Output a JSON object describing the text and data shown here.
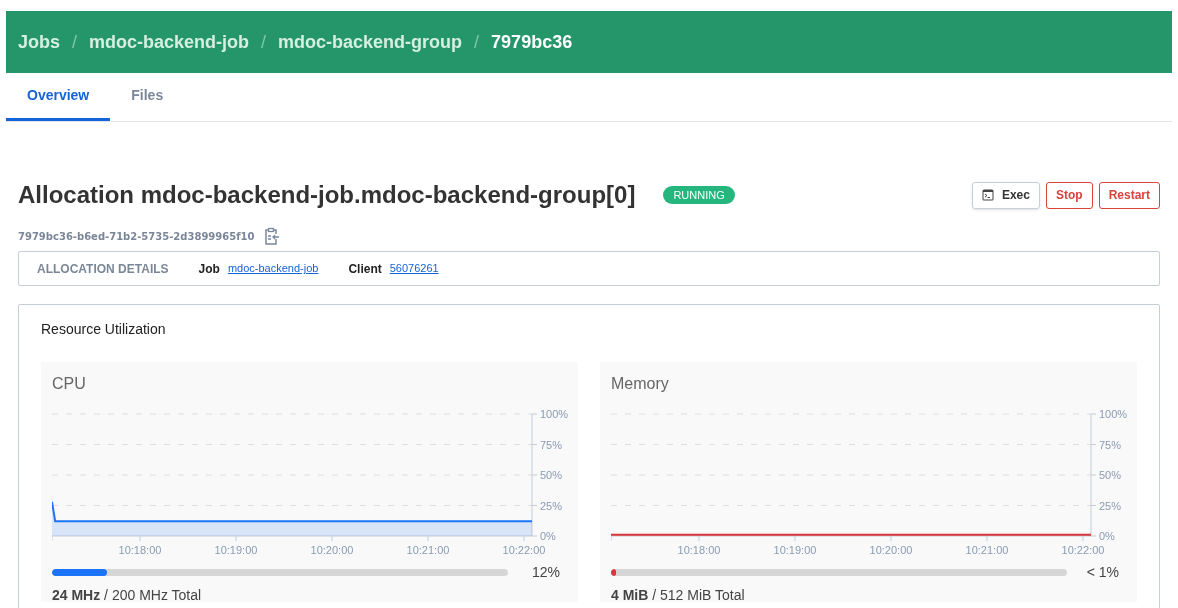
{
  "breadcrumbs": [
    "Jobs",
    "mdoc-backend-job",
    "mdoc-backend-group",
    "7979bc36"
  ],
  "breadcrumb_separator": "/",
  "tabs": [
    {
      "label": "Overview",
      "selected": true
    },
    {
      "label": "Files",
      "selected": false
    }
  ],
  "title": "Allocation mdoc-backend-job.mdoc-backend-group[0]",
  "status": "RUNNING",
  "actions": [
    {
      "label": "Exec",
      "kind": "exec"
    },
    {
      "label": "Stop",
      "kind": "danger"
    },
    {
      "label": "Restart",
      "kind": "danger"
    }
  ],
  "allocation_id": "7979bc36-b6ed-71b2-5735-2d3899965f10",
  "details": {
    "heading": "ALLOCATION DETAILS",
    "fields": [
      {
        "label": "Job",
        "value": "mdoc-backend-job"
      },
      {
        "label": "Client",
        "value": "56076261"
      }
    ]
  },
  "resource_utilization": {
    "title": "Resource Utilization",
    "panels": [
      {
        "title": "CPU",
        "level": 0.12,
        "reading": "12%",
        "summary": "**24 MHz** / 200 MHz Total",
        "chart_data": {
          "type": "area",
          "grid": true,
          "x": [
            37025,
            37027,
            37325
          ],
          "series": [
            {
              "color": "#1a73f8",
              "values": [
                28,
                12,
                12
              ]
            }
          ],
          "xlim": [
            37025,
            37325
          ],
          "ylim": [
            0,
            100
          ],
          "xticks": [
            {
              "value": 37080,
              "label": "10:18:00"
            },
            {
              "value": 37140,
              "label": "10:19:00"
            },
            {
              "value": 37200,
              "label": "10:20:00"
            },
            {
              "value": 37260,
              "label": "10:21:00"
            },
            {
              "value": 37320,
              "label": "10:22:00"
            }
          ],
          "yticks": [
            {
              "value": 0,
              "label": "0%"
            },
            {
              "value": 25,
              "label": "25%"
            },
            {
              "value": 50,
              "label": "50%"
            },
            {
              "value": 75,
              "label": "75%"
            },
            {
              "value": 100,
              "label": "100%"
            }
          ]
        }
      },
      {
        "title": "Memory",
        "level": 0.008,
        "reading": "< 1%",
        "summary": "**4 MiB** / 512 MiB Total",
        "chart_data": {
          "type": "area",
          "grid": true,
          "x": [
            37025,
            37325
          ],
          "series": [
            {
              "color": "#d7363c",
              "values": [
                1,
                1
              ]
            }
          ],
          "xlim": [
            37025,
            37325
          ],
          "ylim": [
            0,
            100
          ],
          "xticks": [
            {
              "value": 37080,
              "label": "10:18:00"
            },
            {
              "value": 37140,
              "label": "10:19:00"
            },
            {
              "value": 37200,
              "label": "10:20:00"
            },
            {
              "value": 37260,
              "label": "10:21:00"
            },
            {
              "value": 37320,
              "label": "10:22:00"
            }
          ],
          "yticks": [
            {
              "value": 0,
              "label": "0%"
            },
            {
              "value": 25,
              "label": "25%"
            },
            {
              "value": 50,
              "label": "50%"
            },
            {
              "value": 75,
              "label": "75%"
            },
            {
              "value": 100,
              "label": "100%"
            }
          ]
        }
      }
    ]
  }
}
